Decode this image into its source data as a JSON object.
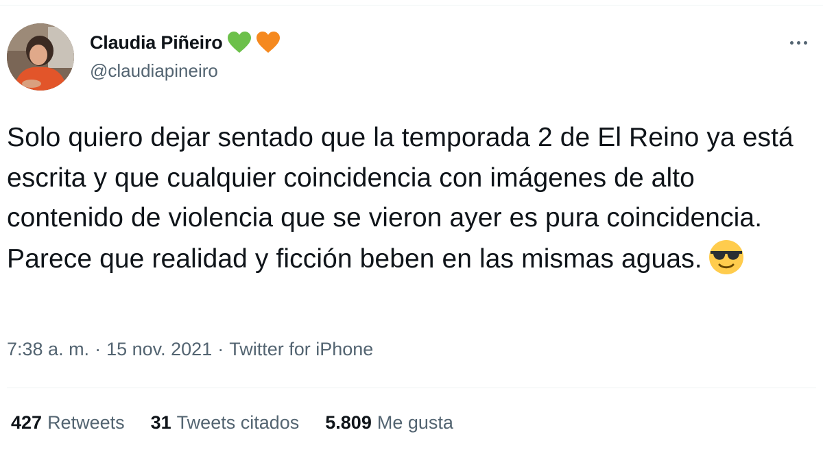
{
  "author": {
    "display_name": "Claudia Piñeiro",
    "handle": "@claudiapineiro",
    "badges": [
      "green-heart-icon",
      "orange-heart-icon"
    ],
    "badge_colors": [
      "#6cc04a",
      "#f5891f"
    ]
  },
  "tweet": {
    "text": "Solo quiero dejar sentado que la temporada 2 de El Reino ya está escrita y que cualquier coincidencia con imágenes de alto contenido de violencia que se vieron ayer es pura coincidencia. Parece que realidad y ficción beben en las mismas aguas.",
    "emoji": "smiling-face-with-sunglasses-icon"
  },
  "meta": {
    "time": "7:38 a. m.",
    "separator": "·",
    "date": "15 nov. 2021",
    "source": "Twitter for iPhone"
  },
  "stats": {
    "retweets_count": "427",
    "retweets_label": "Retweets",
    "quotes_count": "31",
    "quotes_label": "Tweets citados",
    "likes_count": "5.809",
    "likes_label": "Me gusta"
  },
  "colors": {
    "text": "#0f1419",
    "secondary": "#536471",
    "divider": "#eff3f4"
  }
}
